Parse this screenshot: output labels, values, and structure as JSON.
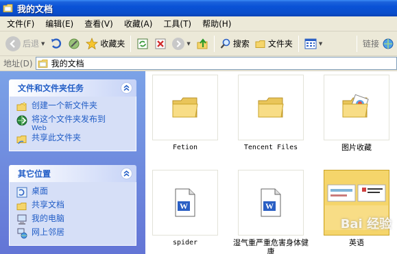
{
  "window": {
    "title": "我的文档"
  },
  "menu": [
    "文件(F)",
    "编辑(E)",
    "查看(V)",
    "收藏(A)",
    "工具(T)",
    "帮助(H)"
  ],
  "toolbar": {
    "back": "后退",
    "favorites": "收藏夹",
    "search": "搜索",
    "folders": "文件夹",
    "links": "链接"
  },
  "address": {
    "label": "地址(D)",
    "value": "我的文档"
  },
  "tasks_panel": {
    "title": "文件和文件夹任务",
    "items": [
      {
        "label": "创建一个新文件夹",
        "sub": "",
        "icon": "new-folder-icon"
      },
      {
        "label": "将这个文件夹发布到",
        "sub": "Web",
        "icon": "publish-web-icon"
      },
      {
        "label": "共享此文件夹",
        "sub": "",
        "icon": "share-folder-icon"
      }
    ]
  },
  "places_panel": {
    "title": "其它位置",
    "items": [
      {
        "label": "桌面",
        "icon": "desktop-icon"
      },
      {
        "label": "共享文档",
        "icon": "shared-docs-icon"
      },
      {
        "label": "我的电脑",
        "icon": "my-computer-icon"
      },
      {
        "label": "网上邻居",
        "icon": "network-places-icon"
      }
    ]
  },
  "files": [
    {
      "name": "Fetion",
      "type": "folder"
    },
    {
      "name": "Tencent Files",
      "type": "folder"
    },
    {
      "name": "图片收藏",
      "type": "picture-folder"
    },
    {
      "name": "spider",
      "type": "word-doc"
    },
    {
      "name": "湿气重严重危害身体健康",
      "type": "word-doc"
    },
    {
      "name": "英语",
      "type": "folder-with-preview"
    }
  ],
  "watermark": "Bai 经验",
  "colors": {
    "titlebar": "#0a52d6",
    "taskpane": "#6f8ee0",
    "link": "#215dc6"
  }
}
